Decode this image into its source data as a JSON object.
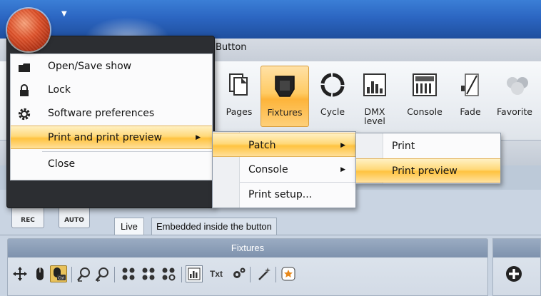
{
  "ribbon": {
    "active_tab": "Button",
    "buttons": [
      {
        "label": "Pages",
        "icon": "pages-icon"
      },
      {
        "label": "Fixtures",
        "icon": "fixture-spot-icon"
      },
      {
        "label": "Cycle",
        "icon": "cycle-icon"
      },
      {
        "label": "DMX level",
        "icon": "dmx-level-icon"
      },
      {
        "label": "Console",
        "icon": "console-icon"
      },
      {
        "label": "Fade",
        "icon": "fade-icon"
      },
      {
        "label": "Favorite",
        "icon": "favorite-icon"
      }
    ]
  },
  "app_menu": {
    "items": [
      {
        "label": "Open/Save show",
        "icon": "folder-save-icon"
      },
      {
        "label": "Lock",
        "icon": "lock-icon"
      },
      {
        "label": "Software preferences",
        "icon": "gear-icon"
      },
      {
        "label": "Print and print preview",
        "has_submenu": true,
        "highlighted": true
      },
      {
        "label": "Close"
      }
    ]
  },
  "print_submenu": {
    "items": [
      {
        "label": "Patch",
        "has_submenu": true,
        "highlighted": true
      },
      {
        "label": "Console",
        "has_submenu": true
      },
      {
        "label": "Print setup..."
      }
    ]
  },
  "patch_submenu": {
    "items": [
      {
        "label": "Print"
      },
      {
        "label": "Print preview",
        "highlighted": true
      }
    ]
  },
  "toolbar": {
    "rec_label": "REC",
    "auto_label": "AUTO",
    "tabs": [
      {
        "label": "Live"
      },
      {
        "label": "Embedded inside the button"
      }
    ]
  },
  "fixtures_panel": {
    "title": "Fixtures",
    "txt_label": "Txt",
    "ctrl_label": "Ctrl"
  },
  "colors": {
    "titlebar": "#2c66c2",
    "highlight": "#ffc340",
    "menu_dark": "#2c2e32"
  }
}
